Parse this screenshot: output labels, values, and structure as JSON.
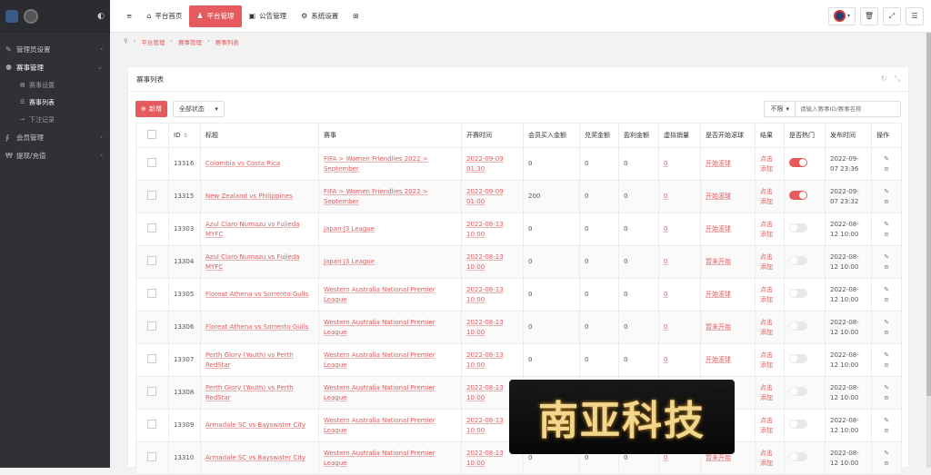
{
  "sidebar": {
    "items": [
      {
        "label": "管理员设置",
        "icon": "wrench-icon",
        "arrow": "‹"
      },
      {
        "label": "赛事管理",
        "icon": "users-icon",
        "arrow": "⌄"
      },
      {
        "label": "赛事设置",
        "icon": "list-icon"
      },
      {
        "label": "赛事列表",
        "icon": "list-icon"
      },
      {
        "label": "下注记录",
        "icon": "arrow-icon"
      },
      {
        "label": "会员管理",
        "icon": "link-icon",
        "arrow": "‹"
      },
      {
        "label": "提现/充值",
        "icon": "wechat-icon",
        "arrow": "‹"
      }
    ]
  },
  "topbar": {
    "tabs": [
      {
        "label": "平台首页",
        "icon": "home-icon"
      },
      {
        "label": "平台管理",
        "icon": "user-icon"
      },
      {
        "label": "公告管理",
        "icon": "card-icon"
      },
      {
        "label": "系统设置",
        "icon": "gear-icon"
      }
    ]
  },
  "breadcrumb": [
    "平台管理",
    "赛事管理",
    "赛事列表"
  ],
  "panel": {
    "title": "赛事列表",
    "add_label": "新增",
    "status_select": "全部状态",
    "limit_label": "不限",
    "search_placeholder": "请输入赛事ID/赛事名称"
  },
  "table": {
    "headers": [
      "ID",
      "标题",
      "赛事",
      "开赛时间",
      "会员买入金额",
      "兑奖金额",
      "盈利金额",
      "虚拟销量",
      "是否开始滚球",
      "结果",
      "是否热门",
      "发布时间",
      "操作"
    ],
    "rows": [
      {
        "id": "13316",
        "title": "Colombia vs Costa Rica",
        "event": "FIFA > Women Friendlies 2022 > September",
        "start": "2022-09-09 01:30",
        "buy": "0",
        "prize": "0",
        "profit": "0",
        "virtual": "0",
        "rolling": "开始滚球",
        "result": "点击添加",
        "hot": true,
        "published": "2022-09-07 23:36"
      },
      {
        "id": "13315",
        "title": "New Zealand vs Philippines",
        "event": "FIFA > Women Friendlies 2022 > September",
        "start": "2022-09-09 01:00",
        "buy": "200",
        "prize": "0",
        "profit": "0",
        "virtual": "0",
        "rolling": "开始滚球",
        "result": "点击添加",
        "hot": true,
        "published": "2022-09-07 23:32"
      },
      {
        "id": "13303",
        "title": "Azul Claro Numazu vs Fujieda MYFC",
        "event": "Japan J3 League",
        "start": "2022-08-13 10:00",
        "buy": "0",
        "prize": "0",
        "profit": "0",
        "virtual": "0",
        "rolling": "开始滚球",
        "result": "点击添加",
        "hot": false,
        "published": "2022-08-12 10:00"
      },
      {
        "id": "13304",
        "title": "Azul Claro Numazu vs Fujieda MYFC",
        "event": "Japan J3 League",
        "start": "2022-08-13 10:00",
        "buy": "0",
        "prize": "0",
        "profit": "0",
        "virtual": "0",
        "rolling": "暂未开始",
        "result": "点击添加",
        "hot": false,
        "published": "2022-08-12 10:00"
      },
      {
        "id": "13305",
        "title": "Floreat Athena vs Sorrento Gulls",
        "event": "Western Australia National Premier League",
        "start": "2022-08-13 10:00",
        "buy": "0",
        "prize": "0",
        "profit": "0",
        "virtual": "0",
        "rolling": "开始滚球",
        "result": "点击添加",
        "hot": false,
        "published": "2022-08-12 10:00"
      },
      {
        "id": "13306",
        "title": "Floreat Athena vs Sorrento Gulls",
        "event": "Western Australia National Premier League",
        "start": "2022-08-13 10:00",
        "buy": "0",
        "prize": "0",
        "profit": "0",
        "virtual": "0",
        "rolling": "暂未开始",
        "result": "点击添加",
        "hot": false,
        "published": "2022-08-12 10:00"
      },
      {
        "id": "13307",
        "title": "Perth Glory (Youth) vs Perth RedStar",
        "event": "Western Australia National Premier League",
        "start": "2022-08-13 10:00",
        "buy": "0",
        "prize": "0",
        "profit": "0",
        "virtual": "0",
        "rolling": "开始滚球",
        "result": "点击添加",
        "hot": false,
        "published": "2022-08-12 10:00"
      },
      {
        "id": "13308",
        "title": "Perth Glory (Youth) vs Perth RedStar",
        "event": "Western Australia National Premier League",
        "start": "2022-08-13 10:00",
        "buy": "0",
        "prize": "0",
        "profit": "0",
        "virtual": "0",
        "rolling": "开始滚球",
        "result": "点击添加",
        "hot": false,
        "published": "2022-08-12 10:00"
      },
      {
        "id": "13309",
        "title": "Armadale SC vs Bayswater City",
        "event": "Western Australia National Premier League",
        "start": "2022-08-13 10:00",
        "buy": "0",
        "prize": "0",
        "profit": "0",
        "virtual": "0",
        "rolling": "开始滚球",
        "result": "点击添加",
        "hot": false,
        "published": "2022-08-12 10:00"
      },
      {
        "id": "13310",
        "title": "Armadale SC vs Bayswater City",
        "event": "Western Australia National Premier League",
        "start": "2022-08-13 10:00",
        "buy": "0",
        "prize": "0",
        "profit": "0",
        "virtual": "0",
        "rolling": "暂未开始",
        "result": "点击添加",
        "hot": false,
        "published": "2022-08-12 10:00"
      }
    ]
  },
  "watermark": "南亚科技",
  "colors": {
    "accent": "#e45a5d",
    "sidebar": "#2f3136"
  }
}
